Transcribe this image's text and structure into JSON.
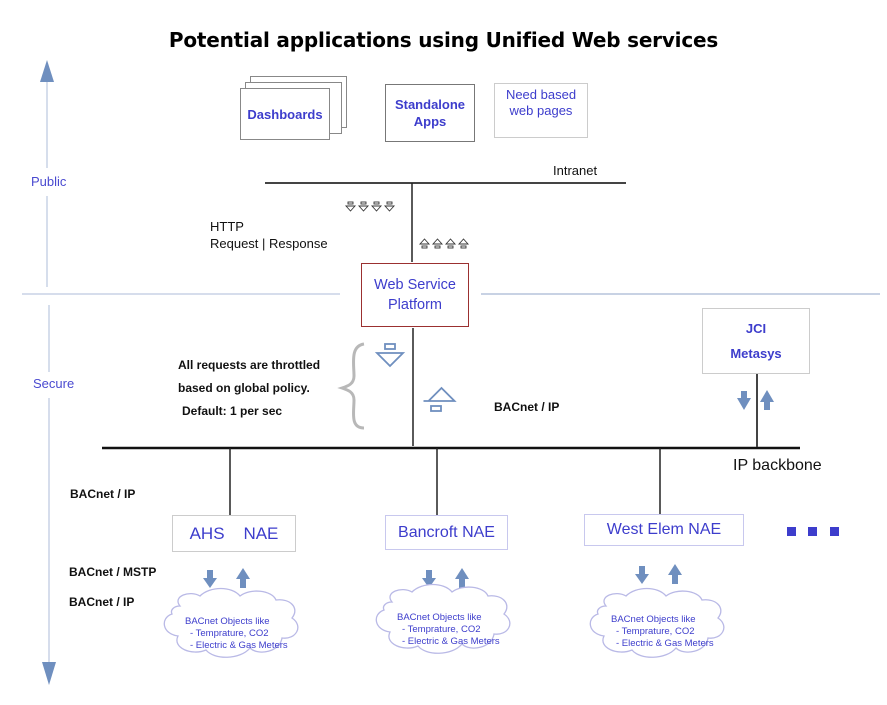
{
  "title": "Potential applications using Unified Web services",
  "zones": {
    "public": "Public",
    "secure": "Secure"
  },
  "apps": {
    "dashboards": "Dashboards",
    "standalone_line1": "Standalone",
    "standalone_line2": "Apps",
    "webpages_line1": "Need based",
    "webpages_line2": "web pages"
  },
  "network": {
    "intranet": "Intranet",
    "ip_backbone": "IP backbone"
  },
  "http": {
    "line1": "HTTP",
    "line2": "Request | Response"
  },
  "platform": {
    "line1": "Web Service",
    "line2": "Platform"
  },
  "throttle": {
    "line1": "All requests are throttled",
    "line2": "based on global policy.",
    "line3": "Default:  1 per sec"
  },
  "protocols": {
    "bacnet_ip_center": "BACnet / IP",
    "bacnet_ip_left": "BACnet / IP",
    "bacnet_mstp": "BACnet / MSTP",
    "bacnet_ip_lower": "BACnet / IP"
  },
  "metasys": {
    "line1": "JCI",
    "line2": "Metasys"
  },
  "naes": [
    {
      "name": "AHS    NAE"
    },
    {
      "name": "Bancroft NAE"
    },
    {
      "name": "West Elem NAE"
    }
  ],
  "cloud": {
    "line1": "BACnet Objects like",
    "line2": "- Temprature, CO2",
    "line3": "- Electric & Gas Meters"
  },
  "colors": {
    "accent_blue": "#3d3dcc",
    "arrow_blue": "#6f8fbf",
    "platform_border": "#9b3030",
    "zone_axis": "#c8d2e6"
  }
}
